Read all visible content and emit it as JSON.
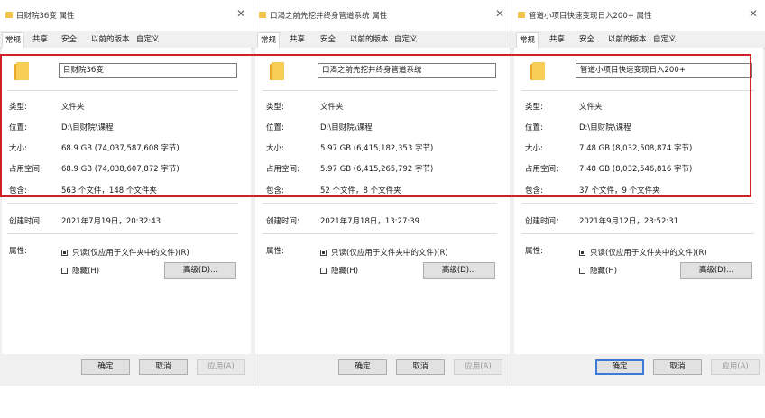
{
  "tabs": [
    "常规",
    "共享",
    "安全",
    "以前的版本",
    "自定义"
  ],
  "labels": {
    "type": "类型:",
    "location": "位置:",
    "size": "大小:",
    "size_on_disk": "占用空间:",
    "contains": "包含:",
    "created": "创建时间:",
    "attributes": "属性:"
  },
  "readonly_label": "只读(仅应用于文件夹中的文件)(R)",
  "hidden_label": "隐藏(H)",
  "advanced_label": "高级(D)...",
  "ok_label": "确定",
  "cancel_label": "取消",
  "apply_label": "应用(A)",
  "windows": [
    {
      "title": "目财院36变 属性",
      "name": "目财院36变",
      "type": "文件夹",
      "location": "D:\\目财院\\课程",
      "size": "68.9 GB (74,037,587,608 字节)",
      "size_on_disk": "68.9 GB (74,038,607,872 字节)",
      "contains": "563 个文件，148 个文件夹",
      "created": "2021年7月19日，20:32:43"
    },
    {
      "title": "口渴之前先挖井终身管道系统 属性",
      "name": "口渴之前先挖井终身管道系统",
      "type": "文件夹",
      "location": "D:\\目财院\\课程",
      "size": "5.97 GB (6,415,182,353 字节)",
      "size_on_disk": "5.97 GB (6,415,265,792 字节)",
      "contains": "52 个文件，8 个文件夹",
      "created": "2021年7月18日，13:27:39"
    },
    {
      "title": "管道小项目快速变现日入200+ 属性",
      "name": "管道小项目快速变现日入200+",
      "type": "文件夹",
      "location": "D:\\目财院\\课程",
      "size": "7.48 GB (8,032,508,874 字节)",
      "size_on_disk": "7.48 GB (8,032,546,816 字节)",
      "contains": "37 个文件，9 个文件夹",
      "created": "2021年9月12日，23:52:31"
    }
  ]
}
